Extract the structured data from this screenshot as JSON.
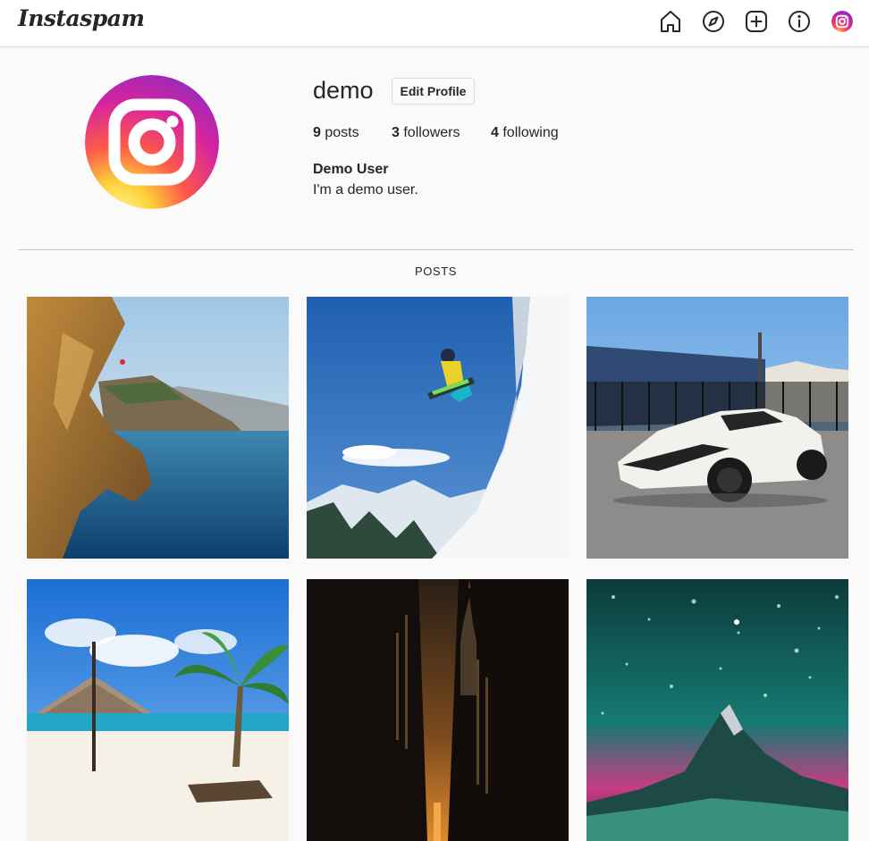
{
  "app": {
    "logo_text": "Instaspam"
  },
  "nav": {
    "icons": [
      "home-icon",
      "explore-icon",
      "new-post-icon",
      "info-icon",
      "profile-avatar-icon"
    ]
  },
  "profile": {
    "username": "demo",
    "edit_button": "Edit Profile",
    "stats": [
      {
        "count": "9",
        "label": "posts"
      },
      {
        "count": "3",
        "label": "followers"
      },
      {
        "count": "4",
        "label": "following"
      }
    ],
    "full_name": "Demo User",
    "bio": "I'm a demo user."
  },
  "tabs": {
    "posts_label": "POSTS"
  },
  "colors": {
    "gradient_yellow": "#feda75",
    "gradient_orange": "#fa7e1e",
    "gradient_pink": "#d62976",
    "gradient_purple": "#962fbf",
    "border": "#dbdbdb",
    "text": "#262626"
  },
  "posts": [
    {
      "subject": "cliff-over-sea"
    },
    {
      "subject": "snowboarder-jump"
    },
    {
      "subject": "white-sports-car"
    },
    {
      "subject": "beach-umbrella-palm"
    },
    {
      "subject": "city-canyon-night"
    },
    {
      "subject": "starry-mountain"
    }
  ]
}
